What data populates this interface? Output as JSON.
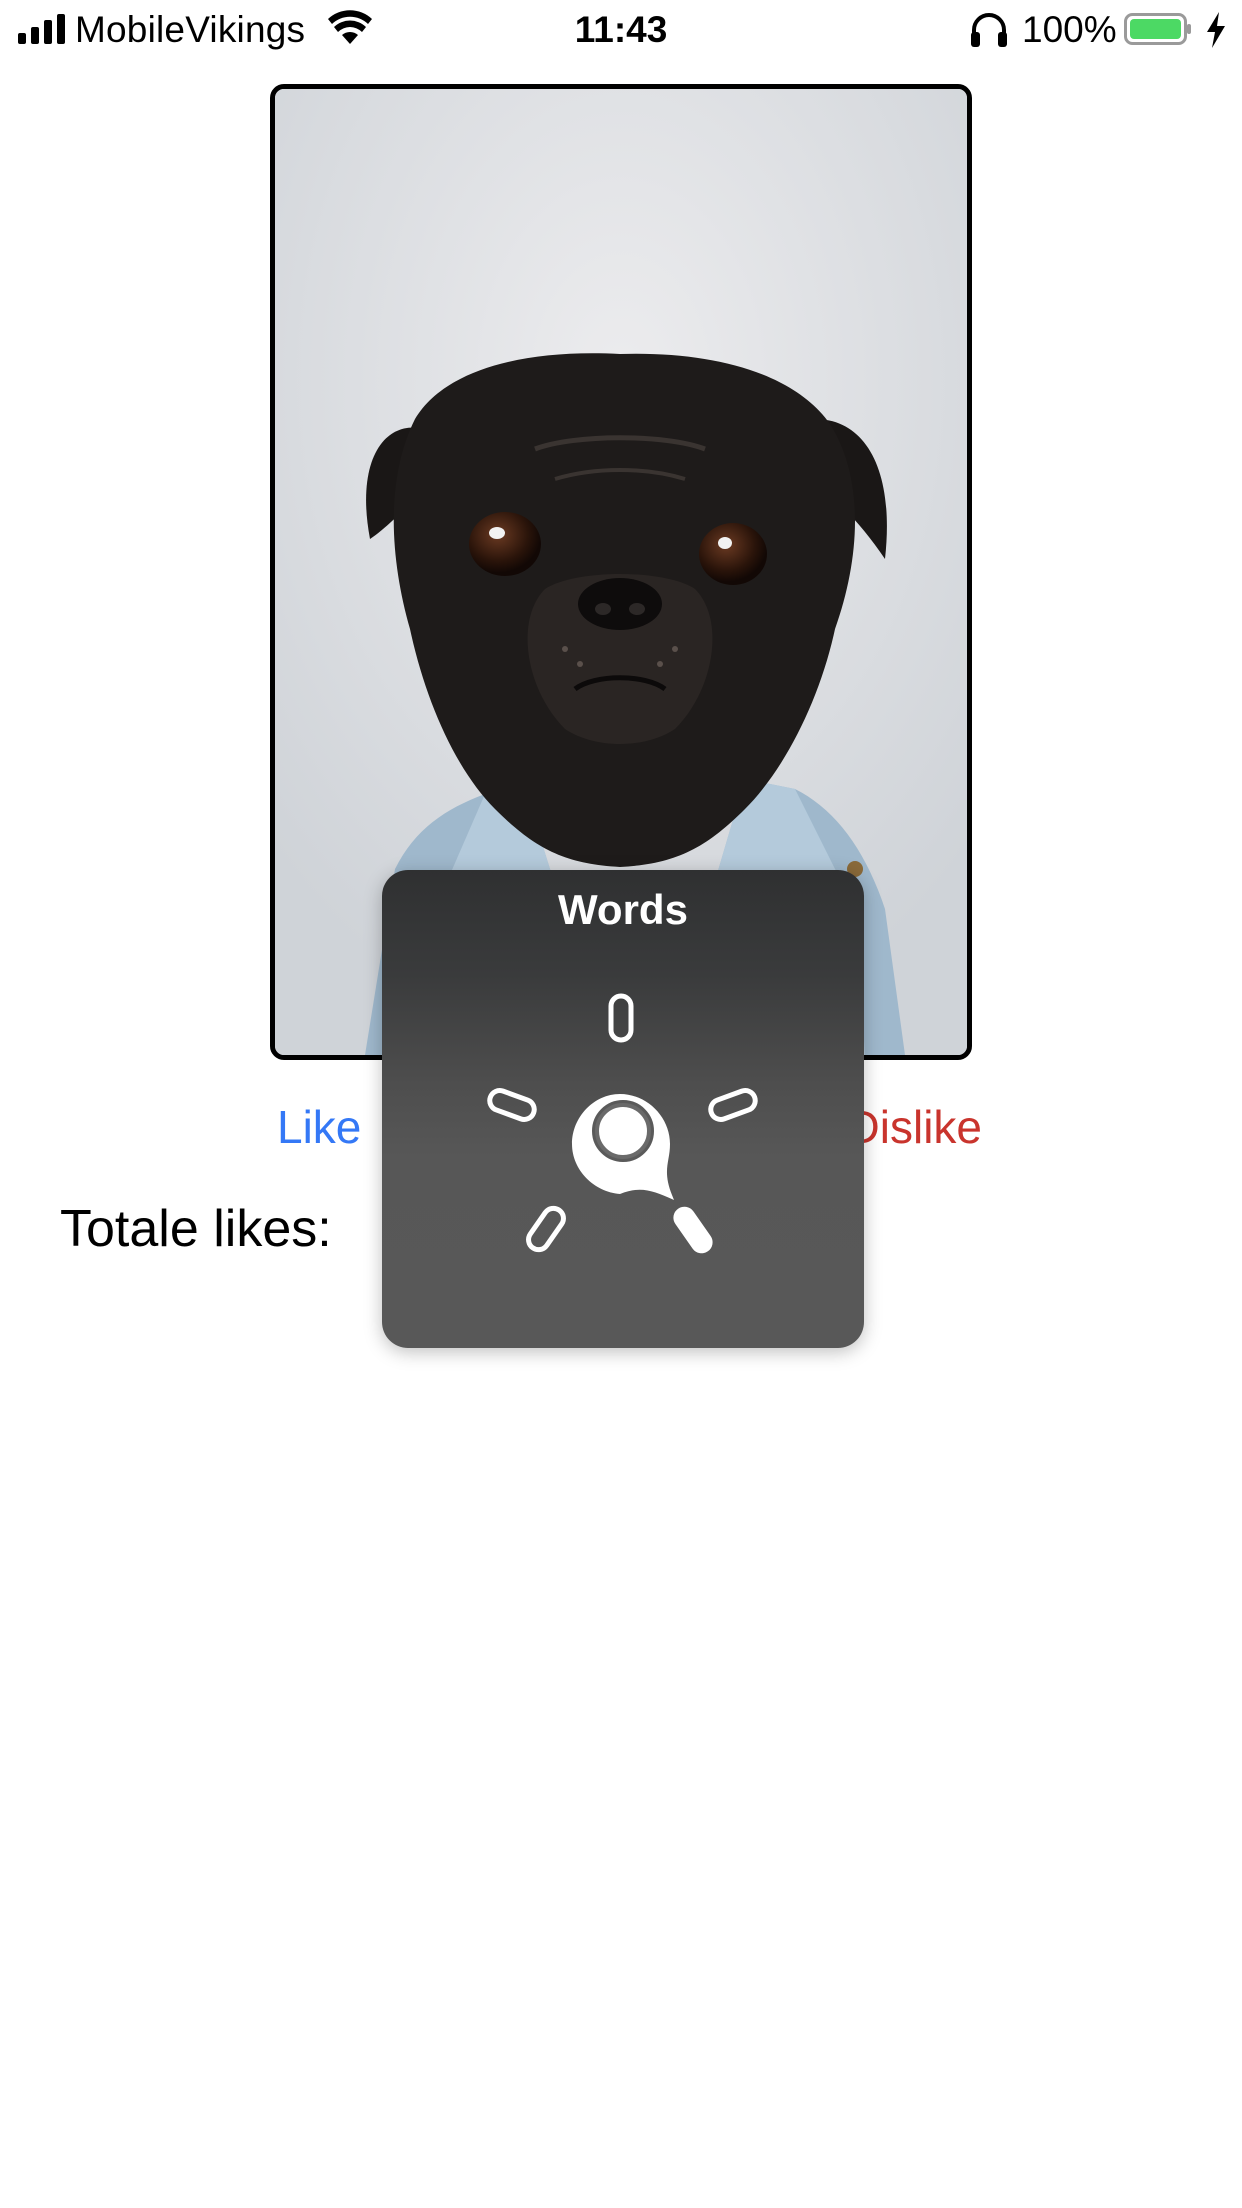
{
  "status_bar": {
    "carrier": "MobileVikings",
    "time": "11:43",
    "battery_percent": "100%",
    "icons": [
      "signal-icon",
      "wifi-icon",
      "headphones-icon",
      "battery-icon",
      "charging-bolt-icon"
    ],
    "battery_color": "#4cd964"
  },
  "photo": {
    "subject": "pug-photo"
  },
  "actions": {
    "like_label": "Like",
    "dislike_label": "Dislike",
    "like_color": "#3478f6",
    "dislike_color": "#c9342d"
  },
  "stats": {
    "total_likes_label": "Totale likes:"
  },
  "rotor": {
    "title": "Words"
  }
}
